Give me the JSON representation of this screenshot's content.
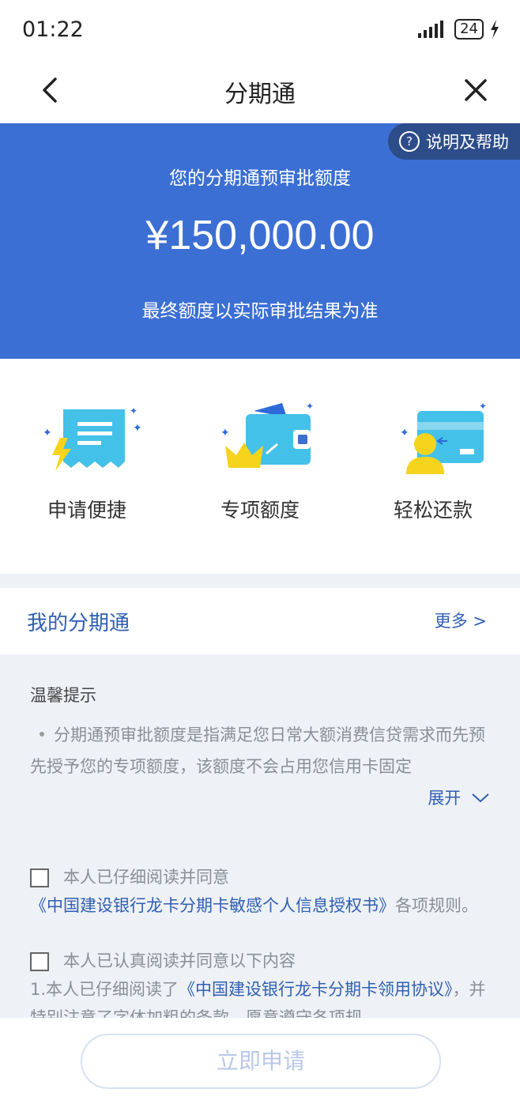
{
  "status": {
    "time": "01:22",
    "signal": "❘❘❘",
    "battery": "24"
  },
  "nav": {
    "title": "分期通"
  },
  "hero": {
    "help_label": "说明及帮助",
    "subtitle": "您的分期通预审批额度",
    "amount": "¥150,000.00",
    "note": "最终额度以实际审批结果为准"
  },
  "features": [
    {
      "label": "申请便捷",
      "icon": "receipt-lightning-icon"
    },
    {
      "label": "专项额度",
      "icon": "wallet-crown-icon"
    },
    {
      "label": "轻松还款",
      "icon": "card-person-icon"
    }
  ],
  "my_installment": {
    "title": "我的分期通",
    "more": "更多 >"
  },
  "tips": {
    "title": "温馨提示",
    "text": "分期通预审批额度是指满足您日常大额消费信贷需求而先预先授予您的专项额度，该额度不会占用您信用卡固定",
    "expand": "展开"
  },
  "agreements": {
    "a1_text": "本人已仔细阅读并同意",
    "a1_link": "《中国建设银行龙卡分期卡敏感个人信息授权书》",
    "a1_suffix": "各项规则。",
    "a2_text": "本人已认真阅读并同意以下内容",
    "a2_line_prefix": "1.本人已仔细阅读了",
    "a2_link": "《中国建设银行龙卡分期卡领用协议》",
    "a2_suffix": "，并特别注意了字体加粗的条款，愿意遵守各项规"
  },
  "apply_button": "立即申请",
  "colors": {
    "brand": "#3c6fd4",
    "link": "#2f5fb3",
    "help_bg": "#2d4c8a"
  }
}
